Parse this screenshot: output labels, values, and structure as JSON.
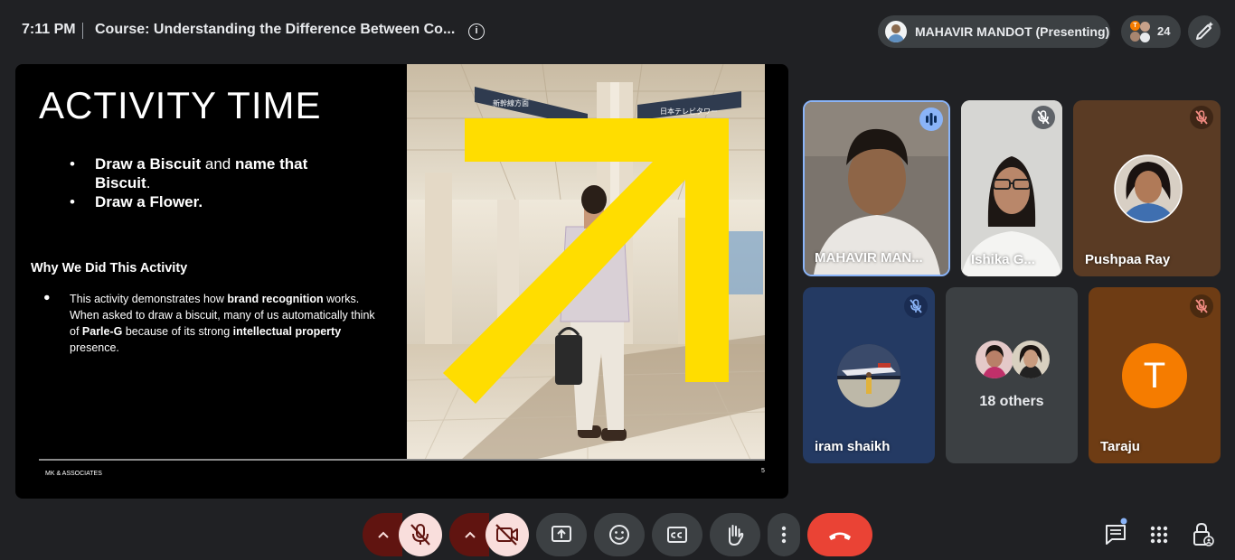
{
  "topbar": {
    "time": "7:11 PM",
    "meeting_title": "Course: Understanding the Difference Between Co...",
    "info_icon_glyph": "i",
    "presenter_label": "MAHAVIR MANDOT (Presenting)",
    "participant_count": "24",
    "mini_avatar_initial": "T"
  },
  "slide": {
    "title": "ACTIVITY TIME",
    "bullets": [
      {
        "bold1": "Draw a Biscuit",
        "normal1": " and ",
        "bold2": "name that Biscuit",
        "normal2": "."
      },
      {
        "bold1": "Draw a Flower.",
        "normal1": "",
        "bold2": "",
        "normal2": ""
      }
    ],
    "why_heading": "Why We Did This Activity",
    "why_bullet_glyph": "●",
    "why_text": {
      "t1": "This activity demonstrates how ",
      "b1": "brand recognition",
      "t2": " works. When asked to draw a biscuit, many of us automatically think of ",
      "b2": "Parle-G",
      "t3": " because of its strong ",
      "b3": "intellectual property",
      "t4": " presence."
    },
    "footer_brand": "MK & ASSOCIATES",
    "page_number": "5",
    "photo_signs": [
      "新幹線方面",
      "日本テレビタワー"
    ]
  },
  "participants": [
    {
      "name": "MAHAVIR MAN...",
      "state": "speaking"
    },
    {
      "name": "Ishika G...",
      "state": "muted"
    },
    {
      "name": "Pushpaa Ray",
      "state": "muted"
    },
    {
      "name": "iram shaikh",
      "state": "muted"
    },
    {
      "name": "18 others",
      "state": "group"
    },
    {
      "name": "Taraju",
      "initial": "T",
      "state": "muted"
    }
  ],
  "controls": {
    "mic": "mic-off-icon",
    "camera": "camera-off-icon",
    "present": "present-screen-icon",
    "reactions": "emoji-icon",
    "captions": "captions-icon",
    "raise_hand": "hand-icon",
    "more": "more-vert-icon",
    "leave": "call-end-icon",
    "chat": "chat-icon",
    "activities": "apps-icon",
    "host_controls": "lock-person-icon"
  },
  "colors": {
    "background": "#202124",
    "chip": "#3c4043",
    "off_control": "#f9dedc",
    "off_arrow": "#601410",
    "leave": "#ea4335",
    "accent_yellow": "#ffdd00",
    "speaking": "#8ab4f8",
    "taraju_avatar": "#f57c00"
  }
}
